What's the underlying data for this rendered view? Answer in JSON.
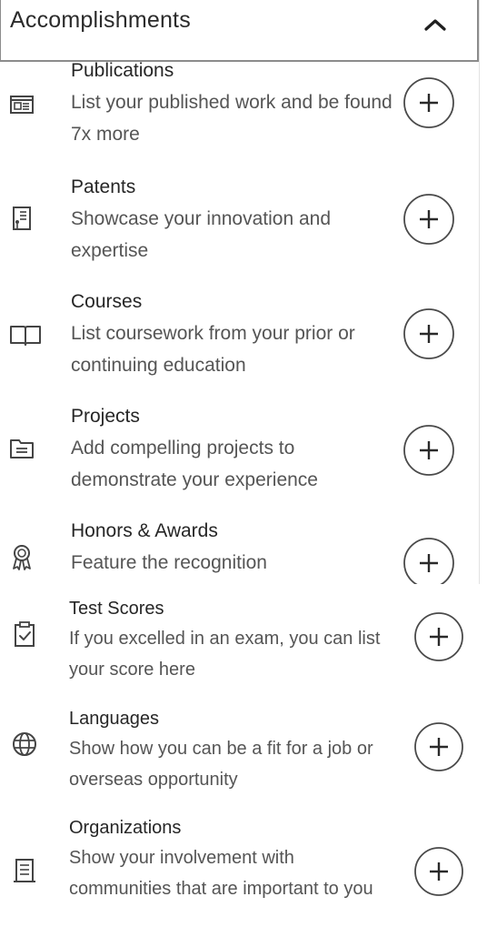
{
  "header": {
    "title": "Accomplishments",
    "collapse_icon": "chevron-up-icon"
  },
  "items": [
    {
      "title": "Publications",
      "description": "List your published work and be found 7x more",
      "icon": "publication-icon"
    },
    {
      "title": "Patents",
      "description": "Showcase your innovation and expertise",
      "icon": "patent-icon"
    },
    {
      "title": "Courses",
      "description": "List coursework from your prior or continuing education",
      "icon": "book-icon"
    },
    {
      "title": "Projects",
      "description": "Add compelling projects to demonstrate your experience",
      "icon": "folder-icon"
    },
    {
      "title": "Honors & Awards",
      "description": "Feature the recognition",
      "icon": "award-icon"
    },
    {
      "title": "Test Scores",
      "description": "If you excelled in an exam, you can list your score here",
      "icon": "clipboard-check-icon"
    },
    {
      "title": "Languages",
      "description": "Show how you can be a fit for a job or overseas opportunity",
      "icon": "globe-icon"
    },
    {
      "title": "Organizations",
      "description": "Show your involvement with communities that are important to you",
      "icon": "building-icon"
    }
  ],
  "add_icon": "plus-circle-icon"
}
